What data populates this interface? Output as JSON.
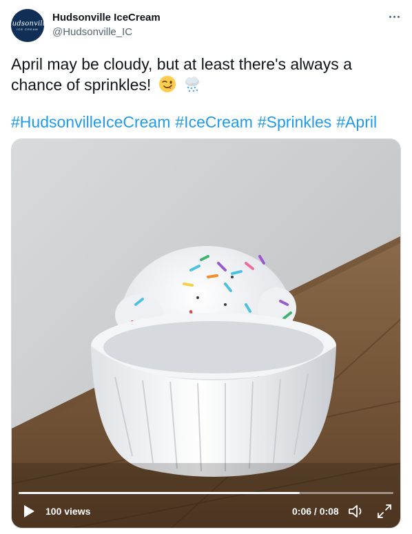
{
  "account": {
    "display_name": "Hudsonville IceCream",
    "handle": "@Hudsonville_IC",
    "avatar_text": "Hudsonville",
    "avatar_subtext": "ICE CREAM"
  },
  "tweet": {
    "text_line1": "April may be cloudy, but at least there's always a",
    "text_line2": "chance of sprinkles!",
    "hashtags": [
      "#HudsonvilleIceCream",
      "#IceCream",
      "#Sprinkles",
      "#April"
    ]
  },
  "video": {
    "views": "100 views",
    "time": "0:06 / 0:08",
    "progress": 0.75
  },
  "icons": [
    "more-icon",
    "wink-emoji-icon",
    "cloud-rain-emoji-icon",
    "play-icon",
    "volume-icon",
    "fullscreen-icon"
  ],
  "colors": {
    "link": "#1d9bf0",
    "secondary_text": "#536471",
    "avatar_bg": "#0f2f57"
  }
}
